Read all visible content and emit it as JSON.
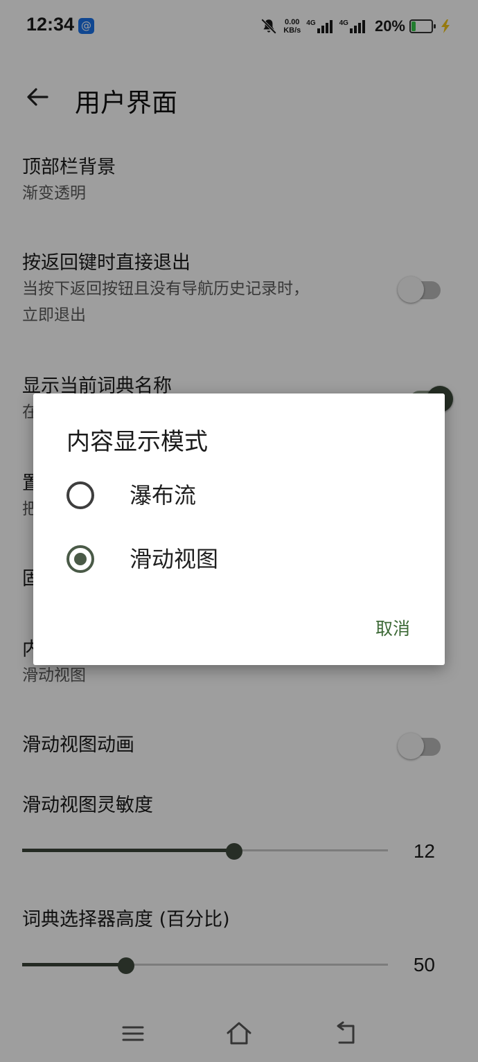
{
  "status_bar": {
    "time": "12:34",
    "app_icon_glyph": "@",
    "net_speed_value": "0.00",
    "net_speed_unit": "KB/s",
    "sim1_label": "4G",
    "sim2_label": "4G",
    "battery_percent": "20%",
    "battery_level": 0.2,
    "battery_color": "#35c84b",
    "charging_color": "#f0c419",
    "icons": [
      "bell-muted-icon",
      "signal-icon",
      "battery-icon",
      "charging-bolt-icon"
    ]
  },
  "header": {
    "back_icon": "arrow-left-icon",
    "title": "用户界面"
  },
  "settings": {
    "top_bar_bg": {
      "title": "顶部栏背景",
      "value": "渐变透明"
    },
    "exit_on_back": {
      "title": "按返回键时直接退出",
      "description_line1": "当按下返回按钮且没有导航历史记录时，",
      "description_line2": "立即退出",
      "enabled": false
    },
    "show_dict_name": {
      "title": "显示当前词典名称",
      "sub_partial": "在",
      "enabled": true
    },
    "partial_item_1": {
      "title_partial": "置",
      "sub_partial": "把"
    },
    "partial_item_2": {
      "title_partial": "固"
    },
    "content_mode": {
      "title_partial": "内",
      "value": "滑动视图"
    },
    "swipe_animation": {
      "title": "滑动视图动画",
      "enabled": false
    },
    "swipe_sensitivity": {
      "title": "滑动视图灵敏度",
      "value": "12",
      "level": 0.58
    },
    "dict_selector_height": {
      "title": "词典选择器高度 (百分比)",
      "value": "50",
      "level": 0.285
    }
  },
  "dialog": {
    "title": "内容显示模式",
    "options": [
      {
        "label": "瀑布流",
        "selected": false
      },
      {
        "label": "滑动视图",
        "selected": true
      }
    ],
    "cancel_label": "取消"
  },
  "navbar": {
    "icons": [
      "menu-icon",
      "home-icon",
      "back-icon"
    ]
  },
  "colors": {
    "accent": "#3d6a37",
    "switch_on_knob": "#3c4a3a",
    "scrim": "rgba(0,0,0,0.375)"
  }
}
